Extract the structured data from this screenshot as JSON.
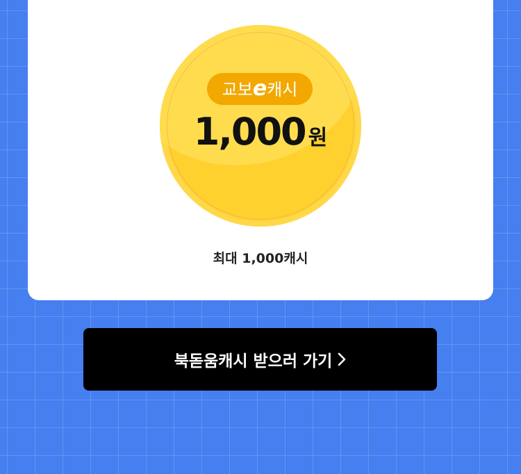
{
  "card": {
    "coin": {
      "badge_prefix": "교보",
      "badge_letter": "e",
      "badge_suffix": "캐시",
      "amount": "1,000",
      "unit": "원"
    },
    "subtitle": "최대 1,000캐시"
  },
  "cta": {
    "label": "북돋움캐시 받으러 가기",
    "icon": "chevron-right-icon"
  },
  "colors": {
    "background": "#457ff0",
    "coin": "#ffd12f",
    "badge": "#f2a800",
    "button": "#000000"
  }
}
